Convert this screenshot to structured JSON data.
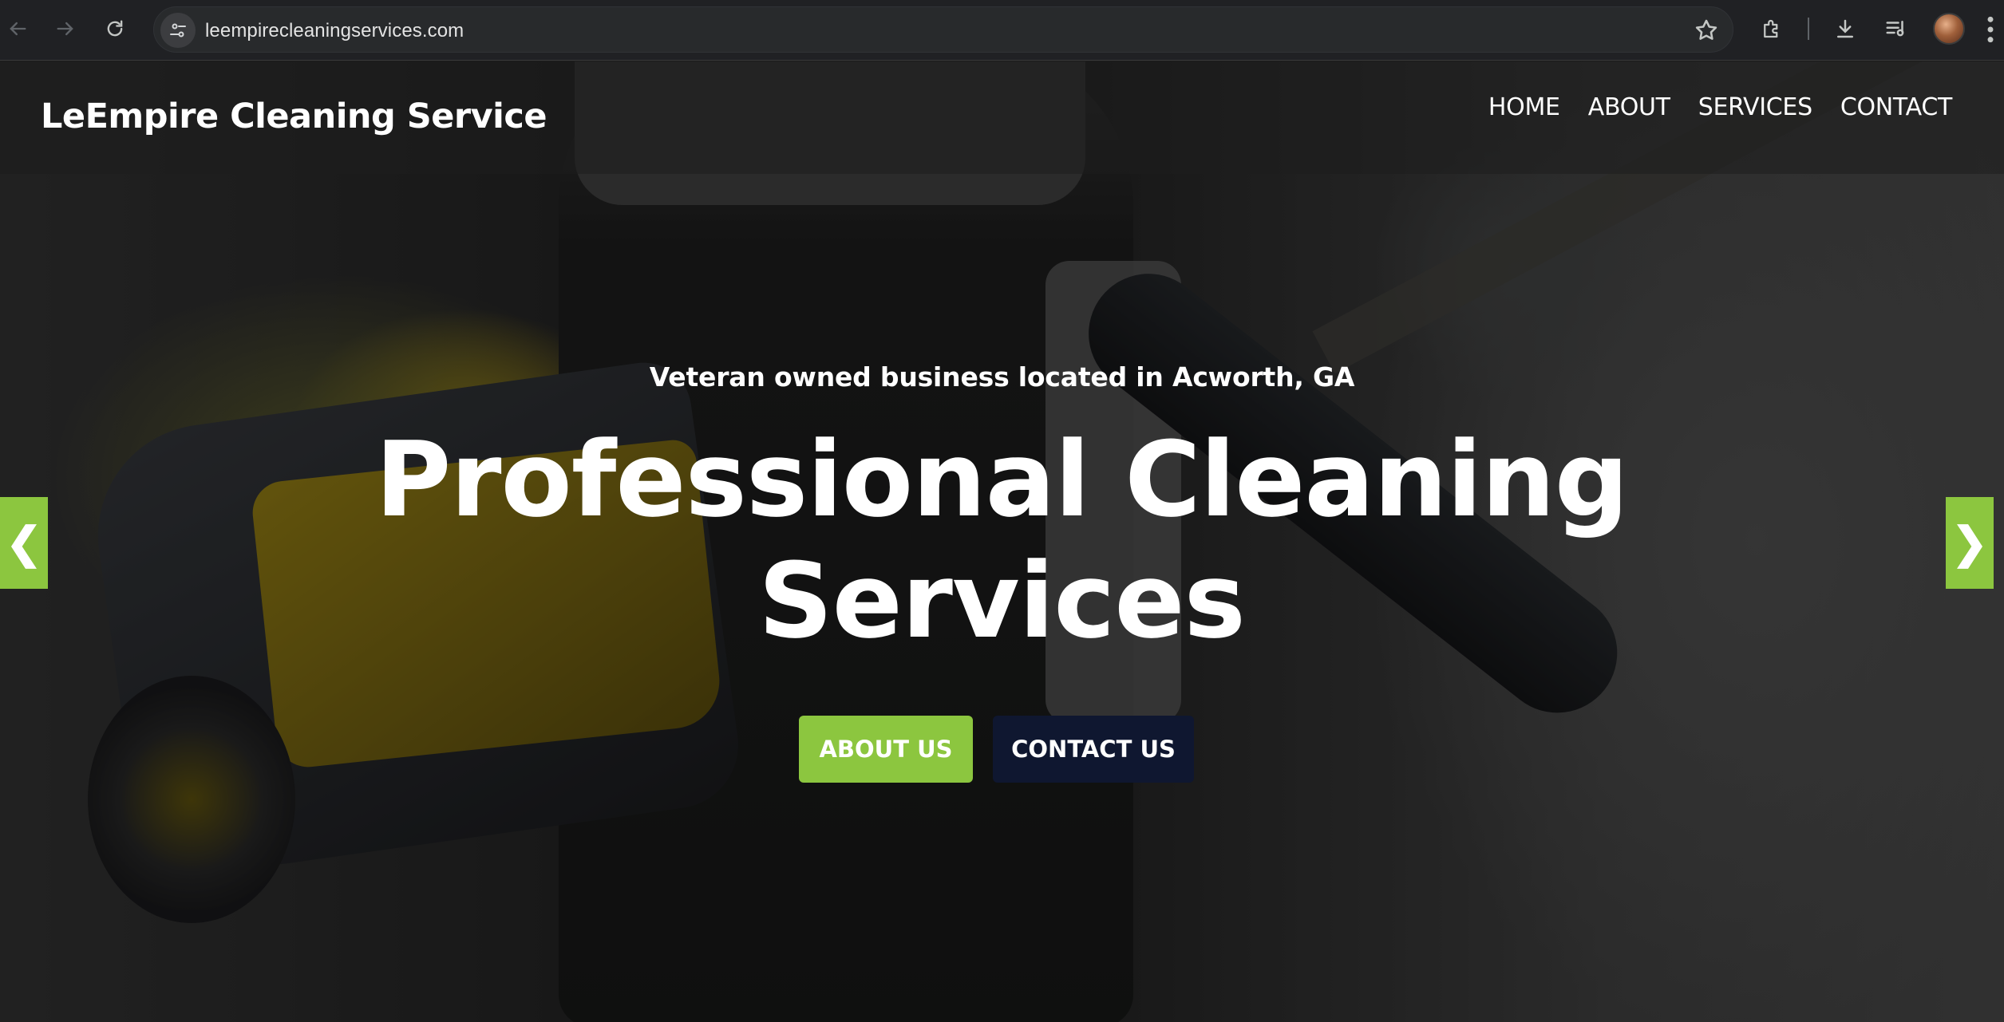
{
  "browser": {
    "url": "leempirecleaningservices.com"
  },
  "site": {
    "brand": "LeEmpire Cleaning Service",
    "nav": [
      "HOME",
      "ABOUT",
      "SERVICES",
      "CONTACT"
    ]
  },
  "hero": {
    "tagline": "Veteran owned business located in Acworth, GA",
    "headline": "Professional Cleaning Services",
    "buttons": {
      "about": "ABOUT US",
      "contact": "CONTACT US"
    },
    "prev_arrow": "❮",
    "next_arrow": "❯"
  },
  "colors": {
    "accent_green": "#8cc63f",
    "navy": "#0f1730"
  }
}
